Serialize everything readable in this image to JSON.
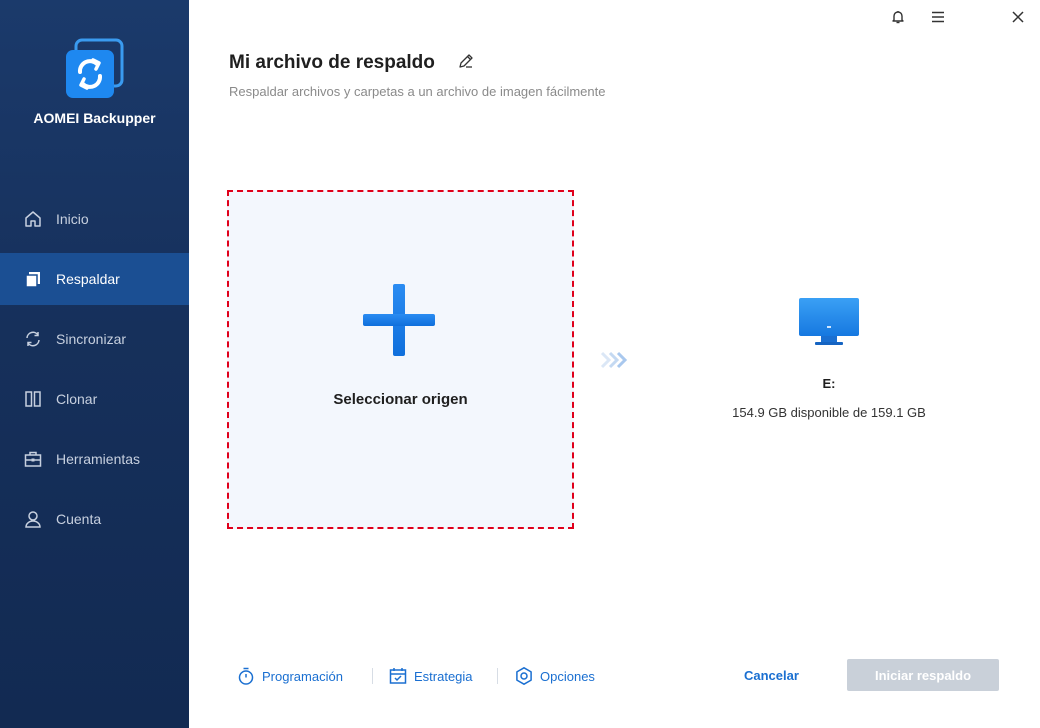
{
  "app": {
    "name": "AOMEI Backupper"
  },
  "sidebar": {
    "items": [
      {
        "label": "Inicio",
        "icon": "home-icon"
      },
      {
        "label": "Respaldar",
        "icon": "backup-icon",
        "active": true
      },
      {
        "label": "Sincronizar",
        "icon": "sync-icon"
      },
      {
        "label": "Clonar",
        "icon": "clone-icon"
      },
      {
        "label": "Herramientas",
        "icon": "toolbox-icon"
      },
      {
        "label": "Cuenta",
        "icon": "user-icon"
      }
    ]
  },
  "header": {
    "title": "Mi archivo de respaldo",
    "subtitle": "Respaldar archivos y carpetas a un archivo de imagen fácilmente"
  },
  "source": {
    "label": "Seleccionar origen"
  },
  "destination": {
    "drive": "E:",
    "space": "154.9 GB disponible de 159.1 GB"
  },
  "footer": {
    "schedule": "Programación",
    "strategy": "Estrategia",
    "options": "Opciones",
    "cancel": "Cancelar",
    "start": "Iniciar respaldo"
  },
  "colors": {
    "sidebar_bg": "#16305b",
    "sidebar_active": "#1b4f93",
    "accent": "#1a6fd1",
    "source_border": "#e0001b",
    "disabled_button": "#c9d0d9"
  }
}
